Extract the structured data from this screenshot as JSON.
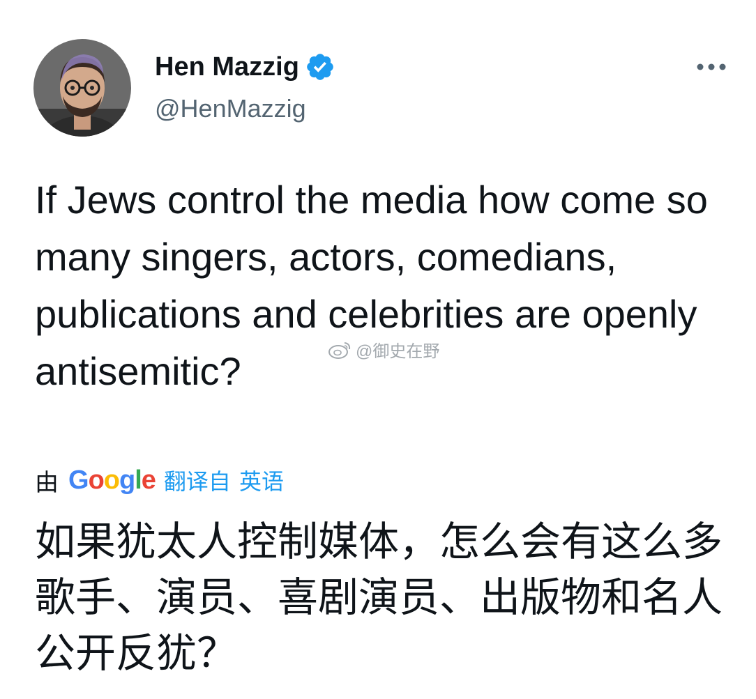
{
  "tweet": {
    "author": {
      "display_name": "Hen Mazzig",
      "handle": "@HenMazzig",
      "verified": true,
      "verified_color": "#1d9bf0"
    },
    "more_icon": "more-dots-icon",
    "text": "If Jews control the media how come so many singers, actors, comedians, publications and celebrities are openly antisemitic?",
    "translation": {
      "prefix": "由",
      "provider_letters": [
        "G",
        "o",
        "o",
        "g",
        "l",
        "e"
      ],
      "provider_colors": [
        "#4285f4",
        "#ea4335",
        "#fbbc05",
        "#4285f4",
        "#34a853",
        "#ea4335"
      ],
      "action": "翻译自",
      "language": "英语",
      "link_color": "#1d9bf0",
      "text": "如果犹太人控制媒体，怎么会有这么多歌手、演员、喜剧演员、出版物和名人公开反犹？"
    }
  },
  "watermark": {
    "icon": "weibo-logo-icon",
    "text": "@御史在野"
  }
}
